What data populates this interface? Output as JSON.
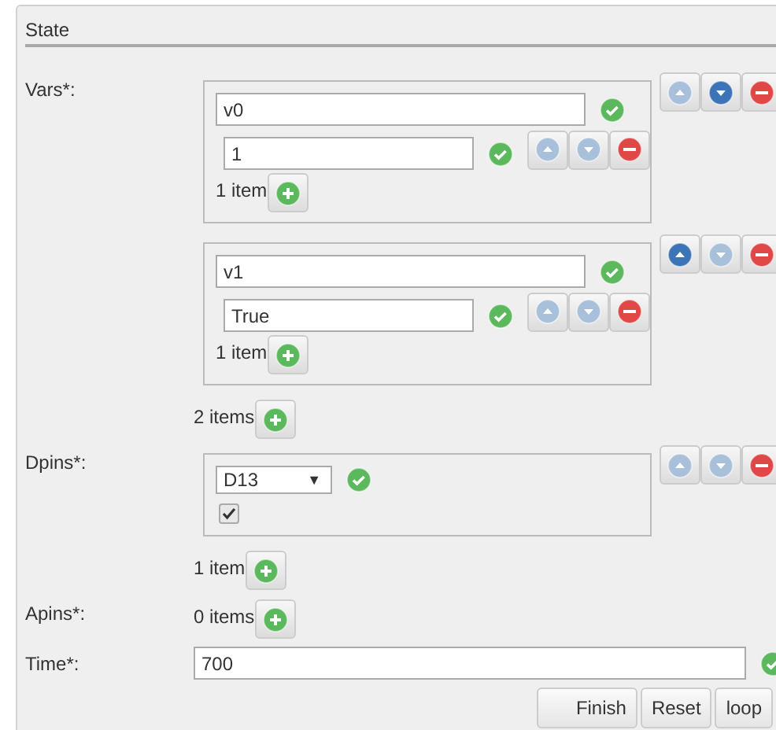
{
  "legend": "State",
  "fields": [
    {
      "kind": "list",
      "label": "Vars*:",
      "items": [
        {
          "kind": "text_list",
          "value": "v0",
          "up_disabled": true,
          "down_disabled": false,
          "entries": [
            {
              "value": "1",
              "up_disabled": true,
              "down_disabled": true
            }
          ],
          "count": "1 item"
        },
        {
          "kind": "text_list",
          "value": "v1",
          "up_disabled": false,
          "down_disabled": true,
          "entries": [
            {
              "value": "True",
              "up_disabled": true,
              "down_disabled": true
            }
          ],
          "count": "1 item"
        }
      ],
      "count": "2 items"
    },
    {
      "kind": "list",
      "label": "Dpins*:",
      "items": [
        {
          "kind": "pin",
          "value": "D13",
          "arrow": "▼",
          "checked": true,
          "up_disabled": true,
          "down_disabled": true
        }
      ],
      "count": "1 item"
    },
    {
      "kind": "list",
      "label": "Apins*:",
      "count": "0 items"
    },
    {
      "kind": "text",
      "label": "Time*:",
      "value": "700"
    }
  ],
  "buttons": [
    "Finish",
    "Reset",
    "loop"
  ]
}
